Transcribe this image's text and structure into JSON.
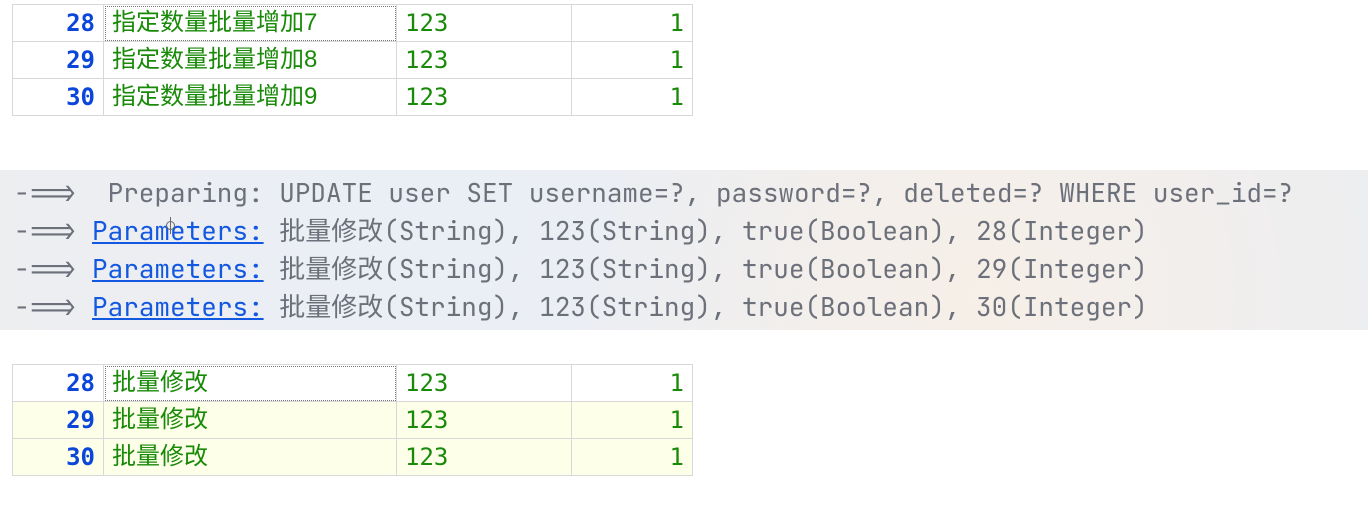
{
  "table_before": {
    "rows": [
      {
        "id": "28",
        "name": "指定数量批量增加7",
        "pwd": "123",
        "del": "1",
        "selected": true,
        "highlight": false
      },
      {
        "id": "29",
        "name": "指定数量批量增加8",
        "pwd": "123",
        "del": "1",
        "selected": false,
        "highlight": false
      },
      {
        "id": "30",
        "name": "指定数量批量增加9",
        "pwd": "123",
        "del": "1",
        "selected": false,
        "highlight": false
      }
    ]
  },
  "table_after": {
    "rows": [
      {
        "id": "28",
        "name": "批量修改",
        "pwd": "123",
        "del": "1",
        "selected": true,
        "highlight": false
      },
      {
        "id": "29",
        "name": "批量修改",
        "pwd": "123",
        "del": "1",
        "selected": false,
        "highlight": true
      },
      {
        "id": "30",
        "name": "批量修改",
        "pwd": "123",
        "del": "1",
        "selected": false,
        "highlight": true
      }
    ]
  },
  "console": {
    "arrow": "-==>",
    "preparing_label": "Preparing:",
    "preparing_sql": "UPDATE user SET username=?, password=?, deleted=? WHERE user_id=?",
    "parameters_label": "Parameters:",
    "param_lines": [
      "批量修改(String), 123(String), true(Boolean), 28(Integer)",
      "批量修改(String), 123(String), true(Boolean), 29(Integer)",
      "批量修改(String), 123(String), true(Boolean), 30(Integer)"
    ]
  }
}
